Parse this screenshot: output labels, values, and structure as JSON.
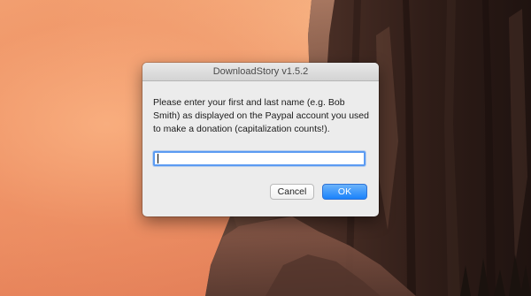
{
  "dialog": {
    "title": "DownloadStory v1.5.2",
    "message": "Please enter your first and last name (e.g. Bob Smith) as displayed on the Paypal account you used to make a donation (capitalization counts!).",
    "name_input": {
      "value": "",
      "placeholder": ""
    },
    "buttons": {
      "cancel_label": "Cancel",
      "ok_label": "OK"
    }
  },
  "colors": {
    "sky_warm": "#ee9064",
    "rock_dark": "#3a2620",
    "dialog_bg": "#ececec",
    "ok_button": "#1a82fb",
    "focus_ring": "#5b9bf2"
  }
}
